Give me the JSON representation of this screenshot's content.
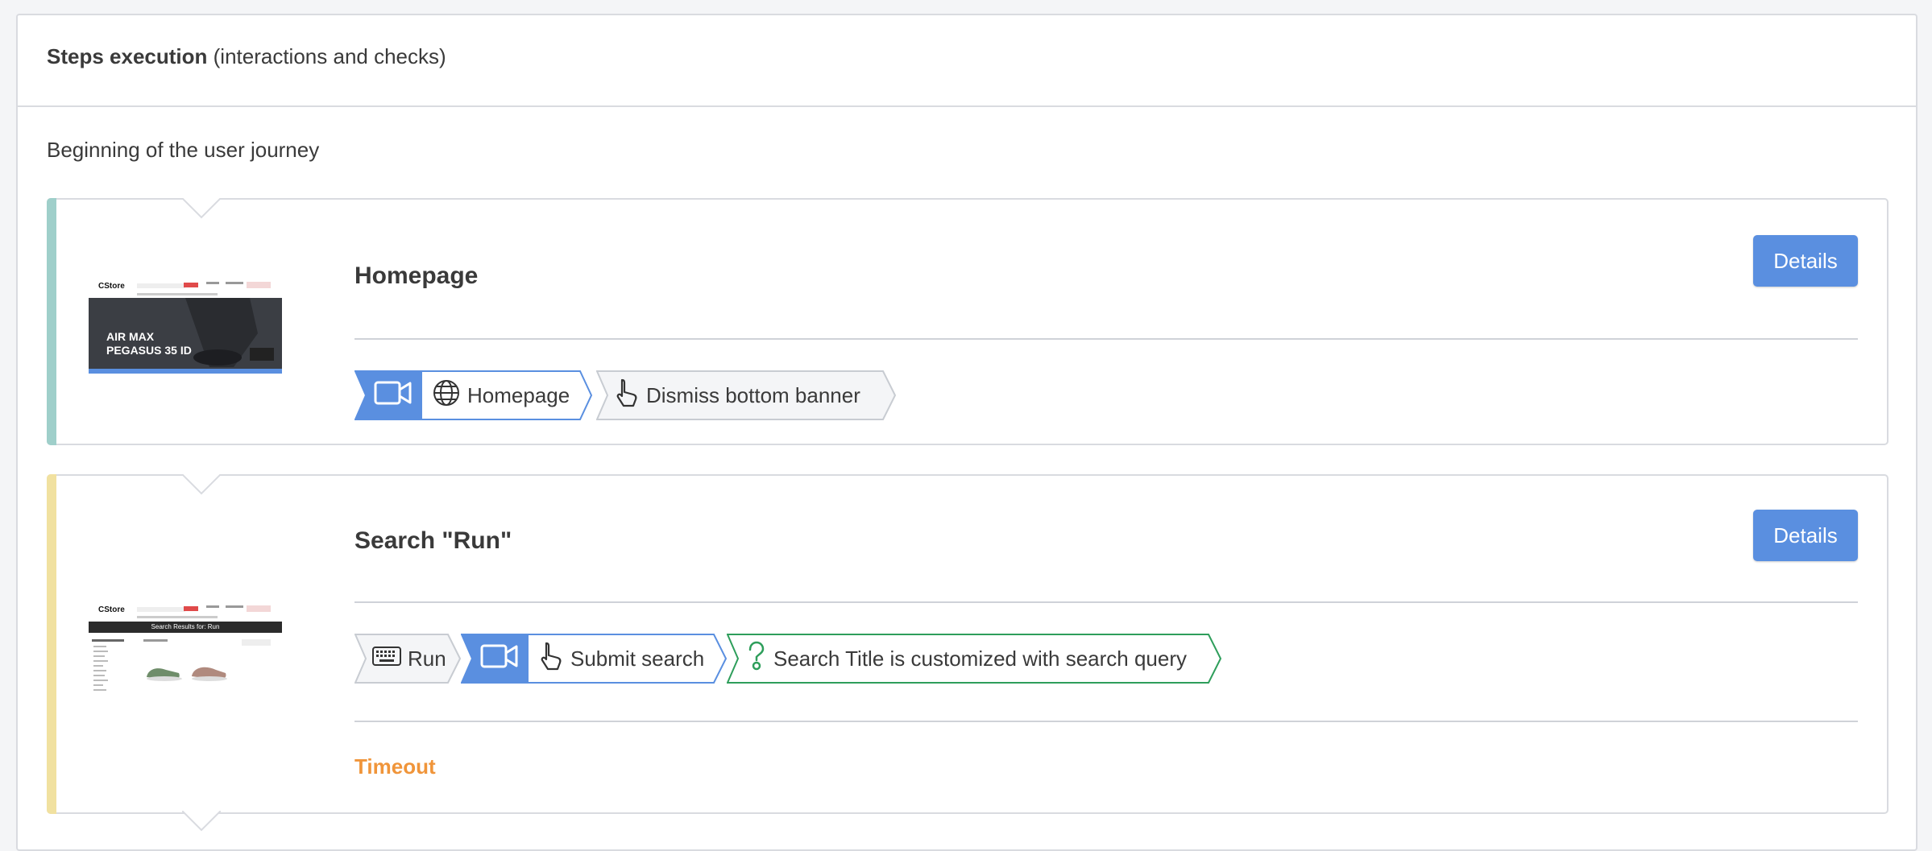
{
  "panel": {
    "title_bold": "Steps execution",
    "title_rest": "(interactions and checks)",
    "journey_start": "Beginning of the user journey"
  },
  "colors": {
    "accent_blue": "#5a8fe0",
    "step1_accent": "#9fcfca",
    "step2_accent": "#f1e1a0",
    "timeout": "#f0953a",
    "check_green": "#2e9e5b"
  },
  "steps": [
    {
      "title": "Homepage",
      "details_label": "Details",
      "thumbnail": {
        "logo": "CStore",
        "hero_line1": "AIR MAX",
        "hero_line2": "PEGASUS 35 ID"
      },
      "chips": [
        {
          "kind": "video",
          "icon": "video-icon"
        },
        {
          "kind": "navigate",
          "icon": "globe-icon",
          "label": "Homepage"
        },
        {
          "kind": "click",
          "icon": "cursor-icon",
          "label": "Dismiss bottom banner"
        }
      ]
    },
    {
      "title": "Search \"Run\"",
      "details_label": "Details",
      "thumbnail": {
        "logo": "CStore",
        "banner": "Search Results for: Run"
      },
      "chips": [
        {
          "kind": "type",
          "icon": "keyboard-icon",
          "label": "Run"
        },
        {
          "kind": "video",
          "icon": "video-icon"
        },
        {
          "kind": "click",
          "icon": "cursor-icon",
          "label": "Submit search"
        },
        {
          "kind": "check",
          "icon": "question-icon",
          "label": "Search Title is customized with search query"
        }
      ],
      "status": "Timeout"
    }
  ]
}
